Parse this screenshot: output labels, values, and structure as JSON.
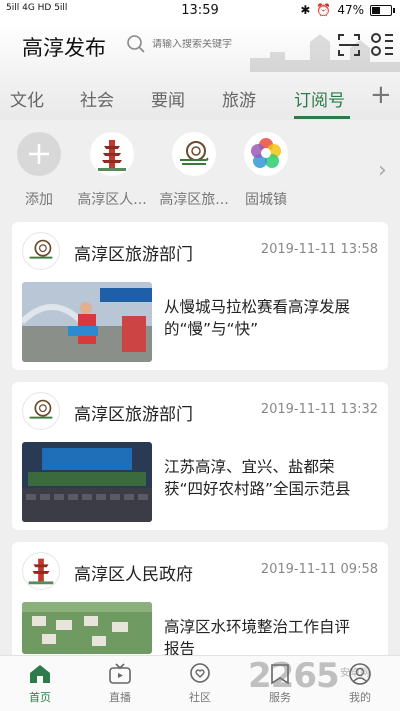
{
  "status_bar": {
    "signal_text": "5ill 4G HD 5ill",
    "time": "13:59",
    "battery": "47%"
  },
  "header": {
    "title": "高淳发布",
    "search_placeholder": "请输入搜索关键字"
  },
  "tabs": [
    {
      "label": "文化"
    },
    {
      "label": "社会"
    },
    {
      "label": "要闻"
    },
    {
      "label": "旅游"
    },
    {
      "label": "订阅号",
      "active": true
    }
  ],
  "subscriptions": [
    {
      "label": "添加",
      "icon": "plus-icon"
    },
    {
      "label": "高淳区人..."
    },
    {
      "label": "高淳区旅..."
    },
    {
      "label": "固城镇"
    }
  ],
  "feed": [
    {
      "source": "高淳区旅游部门",
      "time": "2019-11-11 13:58",
      "headline_lines": [
        "从慢城马拉松赛看高淳发展",
        "的“慢”与“快”"
      ]
    },
    {
      "source": "高淳区旅游部门",
      "time": "2019-11-11 13:32",
      "headline_lines": [
        "江苏高淳、宜兴、盐都荣",
        "获“四好农村路”全国示范县"
      ]
    },
    {
      "source": "高淳区人民政府",
      "time": "2019-11-11 09:58",
      "headline_lines": [
        "高淳区水环境整治工作自评",
        "报告"
      ]
    }
  ],
  "bottom_nav": [
    {
      "label": "首页",
      "icon": "home-icon",
      "active": true
    },
    {
      "label": "直播",
      "icon": "tv-icon"
    },
    {
      "label": "社区",
      "icon": "heart-chat-icon"
    },
    {
      "label": "服务",
      "icon": "bookmark-icon"
    },
    {
      "label": "我的",
      "icon": "user-icon"
    }
  ],
  "watermark": {
    "text": "2265",
    "sub": "安卓网"
  },
  "colors": {
    "accent": "#2d7a4a",
    "background": "#efefef"
  }
}
